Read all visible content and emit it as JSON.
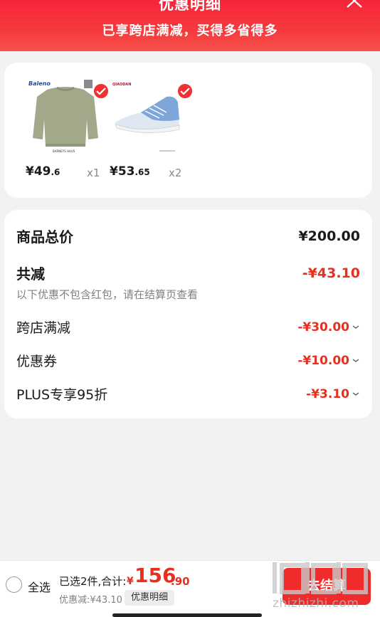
{
  "header": {
    "title": "优惠明细",
    "subtitle": "已享跨店满减，买得多省得多"
  },
  "products": [
    {
      "price_int": "¥49",
      "price_dec": ".6",
      "qty": "x1",
      "brand": "Baleno"
    },
    {
      "price_int": "¥53",
      "price_dec": ".65",
      "qty": "x2",
      "brand": "QIAODAN"
    }
  ],
  "summary": {
    "total_label": "商品总价",
    "total_value": "¥200.00",
    "discount_label": "共减",
    "discount_value": "-¥43.10",
    "note": "以下优惠不包含红包，请在结算页查看",
    "items": [
      {
        "label": "跨店满减",
        "value": "-¥30.00"
      },
      {
        "label": "优惠券",
        "value": "-¥10.00"
      },
      {
        "label": "PLUS专享95折",
        "value": "-¥3.10"
      }
    ]
  },
  "bottom": {
    "select_all": "全选",
    "selected_text": "已选2件,合计:",
    "total_currency": "¥",
    "total_int": "156",
    "total_dec": ".90",
    "discount_text": "优惠减:¥43.10",
    "detail_button": "优惠明细",
    "checkout_button": "去结算"
  },
  "watermark": {
    "text": "zhizhizhi.com"
  },
  "colors": {
    "accent": "#f23030",
    "header": "#f53a3e",
    "price_red": "#e8301f"
  }
}
